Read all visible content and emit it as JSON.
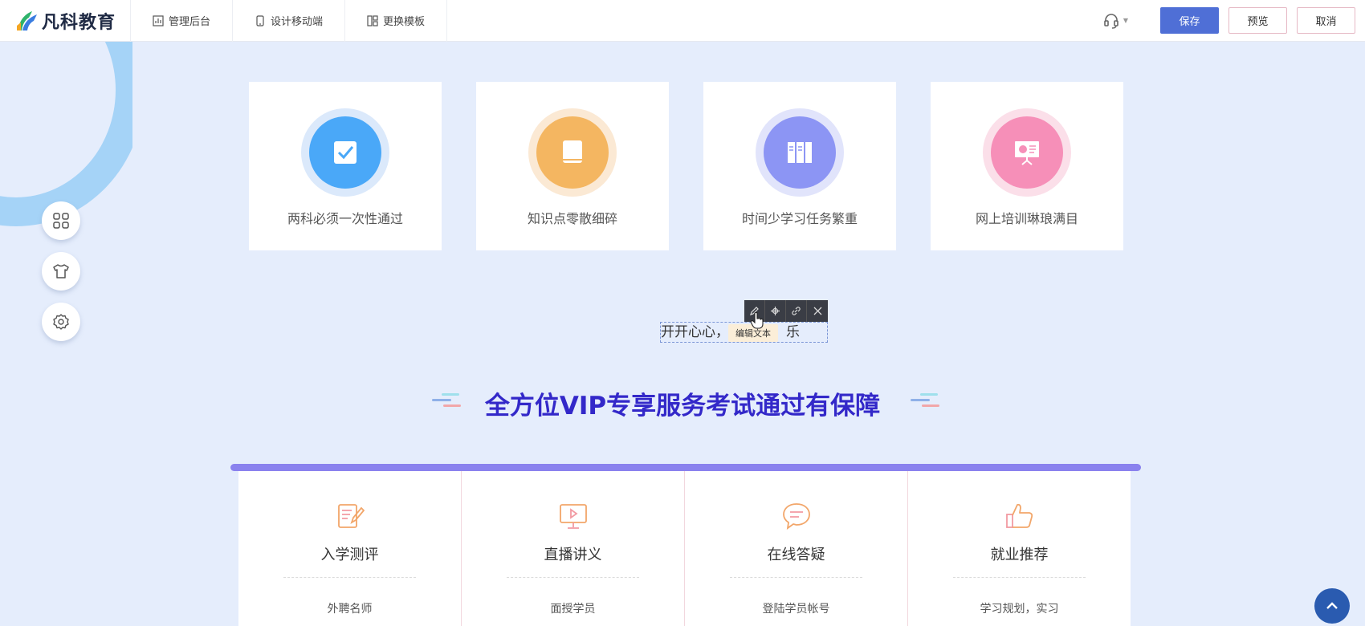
{
  "topbar": {
    "brand": "凡科教育",
    "nav": [
      {
        "label": "管理后台",
        "icon": "chart-icon"
      },
      {
        "label": "设计移动端",
        "icon": "mobile-icon"
      },
      {
        "label": "更换模板",
        "icon": "template-icon"
      }
    ],
    "save_label": "保存",
    "preview_label": "预览",
    "cancel_label": "取消"
  },
  "side_tools": [
    "modules-icon",
    "shirt-icon",
    "settings-icon"
  ],
  "feature_cards": [
    {
      "label": "两科必须一次性通过",
      "color": "#4aa8f8",
      "ring": "#dbe9fb",
      "icon": "checkbox-icon"
    },
    {
      "label": "知识点零散细碎",
      "color": "#f4b661",
      "ring": "#fbe9d4",
      "icon": "book-icon"
    },
    {
      "label": "时间少学习任务繁重",
      "color": "#8c95f4",
      "ring": "#e1e4fb",
      "icon": "books-icon"
    },
    {
      "label": "网上培训琳琅满目",
      "color": "#f68fb8",
      "ring": "#fbdfe9",
      "icon": "presentation-icon"
    }
  ],
  "edit_text": {
    "content_left": "开开心心，",
    "content_right": "乐",
    "tooltip": "编辑文本",
    "toolbar_icons": [
      "pencil-icon",
      "move-icon",
      "link-icon",
      "close-icon"
    ]
  },
  "section_heading": "全方位VIP专享服务考试通过有保障",
  "services": [
    {
      "title": "入学测评",
      "sub": "外聘名师",
      "icon": "edit-doc-icon"
    },
    {
      "title": "直播讲义",
      "sub": "面授学员",
      "icon": "live-icon"
    },
    {
      "title": "在线答疑",
      "sub": "登陆学员帐号",
      "icon": "chat-icon"
    },
    {
      "title": "就业推荐",
      "sub": "学习规划，实习",
      "icon": "thumbs-up-icon"
    }
  ],
  "colors": {
    "accent": "#4f6fd6",
    "heading": "#3328c9",
    "bar": "#8a82ee",
    "background": "#e5edfc"
  }
}
